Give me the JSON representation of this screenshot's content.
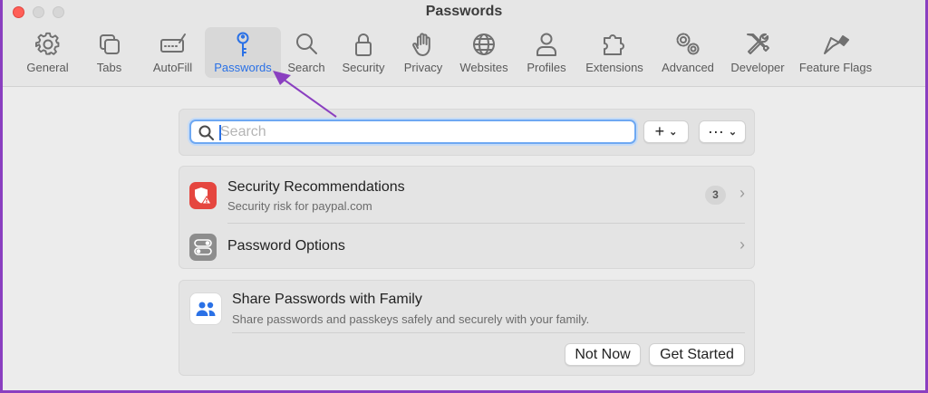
{
  "window": {
    "title": "Passwords"
  },
  "toolbar": {
    "tabs": [
      {
        "label": "General",
        "icon": "gear-icon"
      },
      {
        "label": "Tabs",
        "icon": "tabs-icon"
      },
      {
        "label": "AutoFill",
        "icon": "autofill-icon"
      },
      {
        "label": "Passwords",
        "icon": "key-icon",
        "selected": true
      },
      {
        "label": "Search",
        "icon": "magnifier-icon"
      },
      {
        "label": "Security",
        "icon": "lock-icon"
      },
      {
        "label": "Privacy",
        "icon": "hand-icon"
      },
      {
        "label": "Websites",
        "icon": "globe-icon"
      },
      {
        "label": "Profiles",
        "icon": "person-icon"
      },
      {
        "label": "Extensions",
        "icon": "puzzle-icon"
      },
      {
        "label": "Advanced",
        "icon": "gears-icon"
      },
      {
        "label": "Developer",
        "icon": "tools-icon"
      },
      {
        "label": "Feature Flags",
        "icon": "flags-icon"
      }
    ]
  },
  "search": {
    "placeholder": "Search",
    "value": ""
  },
  "actions": {
    "add_label": "+",
    "more_label": "···"
  },
  "list": {
    "security": {
      "title": "Security Recommendations",
      "subtitle": "Security risk for paypal.com",
      "count": "3"
    },
    "options": {
      "title": "Password Options"
    }
  },
  "share": {
    "title": "Share Passwords with Family",
    "subtitle": "Share passwords and passkeys safely and securely with your family.",
    "not_now_label": "Not Now",
    "get_started_label": "Get Started"
  },
  "colors": {
    "accent": "#2a71e6",
    "annotation": "#8a3fc0",
    "alert_red": "#e5463f"
  }
}
